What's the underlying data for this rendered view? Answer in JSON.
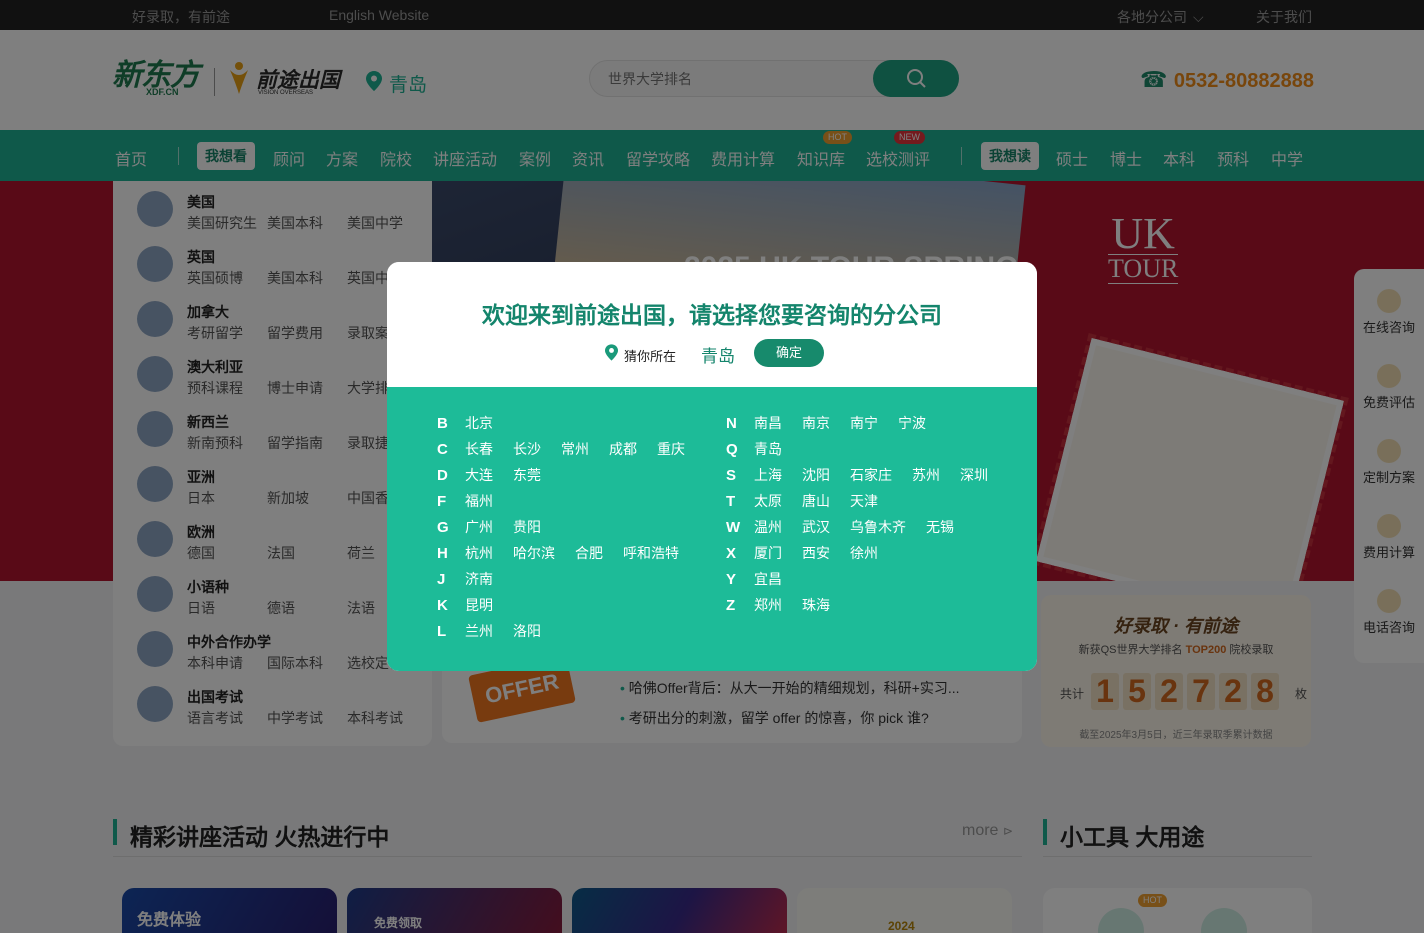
{
  "topbar": {
    "slogan": "好录取，有前途",
    "english": "English Website",
    "branches": "各地分公司",
    "about": "关于我们"
  },
  "header": {
    "logo_xdf": "新东方",
    "logo_xdf_sub": "XDF.CN",
    "logo_vision": "前途出国",
    "logo_vision_sub": "VISION OVERSEAS",
    "city": "青岛",
    "search_placeholder": "世界大学排名",
    "phone": "0532-80882888"
  },
  "nav": {
    "home": "首页",
    "want_see": "我想看",
    "items_see": [
      "顾问",
      "方案",
      "院校",
      "讲座活动",
      "案例",
      "资讯",
      "留学攻略",
      "费用计算",
      "知识库",
      "选校测评"
    ],
    "badge_hot": "HOT",
    "badge_new": "NEW",
    "want_read": "我想读",
    "items_read": [
      "硕士",
      "博士",
      "本科",
      "预科",
      "中学"
    ]
  },
  "banner": {
    "uk": "UK",
    "tour": "TOUR",
    "headline": "2025 UK TOUR SPRING"
  },
  "menu": [
    {
      "title": "美国",
      "subs": [
        "美国研究生",
        "美国本科",
        "美国中学"
      ]
    },
    {
      "title": "英国",
      "subs": [
        "英国硕博",
        "美国本科",
        "英国中学"
      ]
    },
    {
      "title": "加拿大",
      "subs": [
        "考研留学",
        "留学费用",
        "录取案例"
      ]
    },
    {
      "title": "澳大利亚",
      "subs": [
        "预科课程",
        "博士申请",
        "大学排名"
      ]
    },
    {
      "title": "新西兰",
      "subs": [
        "新南预科",
        "留学指南",
        "录取捷报"
      ]
    },
    {
      "title": "亚洲",
      "subs": [
        "日本",
        "新加坡",
        "中国香港"
      ]
    },
    {
      "title": "欧洲",
      "subs": [
        "德国",
        "法国",
        "荷兰"
      ]
    },
    {
      "title": "小语种",
      "subs": [
        "日语",
        "德语",
        "法语"
      ]
    },
    {
      "title": "中外合作办学",
      "subs": [
        "本科申请",
        "国际本科",
        "选校定位"
      ]
    },
    {
      "title": "出国考试",
      "subs": [
        "语言考试",
        "中学考试",
        "本科考试"
      ]
    }
  ],
  "offer": {
    "stamp": "OFFER",
    "news": [
      "哈佛Offer背后：从大一开始的精细规划，科研+实习...",
      "考研出分的刺激，留学 offer 的惊喜，你 pick 谁?"
    ]
  },
  "stats": {
    "slogan": "好录取 · 有前途",
    "sub_prefix": "新获QS世界大学排名",
    "sub_highlight": "TOP200",
    "sub_suffix": "院校录取",
    "total_label": "共计",
    "digits": [
      "1",
      "5",
      "2",
      "7",
      "2",
      "8"
    ],
    "unit": "枚",
    "note": "截至2025年3月5日，近三年录取季累计数据"
  },
  "rightbar": [
    "在线咨询",
    "免费评估",
    "定制方案",
    "费用计算",
    "电话咨询"
  ],
  "sections": {
    "lectures": "精彩讲座活动 火热进行中",
    "more": "more",
    "tools": "小工具 大用途"
  },
  "bottom_cards": {
    "card1": "免费体验",
    "card2": "免费领取",
    "card4": "2024",
    "badge_hot": "HOT"
  },
  "modal": {
    "title": "欢迎来到前途出国，请选择您要咨询的分公司",
    "guess_label": "猜你所在",
    "guess_city": "青岛",
    "confirm": "确定",
    "left": [
      {
        "letter": "B",
        "cities": [
          "北京"
        ]
      },
      {
        "letter": "C",
        "cities": [
          "长春",
          "长沙",
          "常州",
          "成都",
          "重庆"
        ]
      },
      {
        "letter": "D",
        "cities": [
          "大连",
          "东莞"
        ]
      },
      {
        "letter": "F",
        "cities": [
          "福州"
        ]
      },
      {
        "letter": "G",
        "cities": [
          "广州",
          "贵阳"
        ]
      },
      {
        "letter": "H",
        "cities": [
          "杭州",
          "哈尔滨",
          "合肥",
          "呼和浩特"
        ]
      },
      {
        "letter": "J",
        "cities": [
          "济南"
        ]
      },
      {
        "letter": "K",
        "cities": [
          "昆明"
        ]
      },
      {
        "letter": "L",
        "cities": [
          "兰州",
          "洛阳"
        ]
      }
    ],
    "right": [
      {
        "letter": "N",
        "cities": [
          "南昌",
          "南京",
          "南宁",
          "宁波"
        ]
      },
      {
        "letter": "Q",
        "cities": [
          "青岛"
        ]
      },
      {
        "letter": "S",
        "cities": [
          "上海",
          "沈阳",
          "石家庄",
          "苏州",
          "深圳"
        ]
      },
      {
        "letter": "T",
        "cities": [
          "太原",
          "唐山",
          "天津"
        ]
      },
      {
        "letter": "W",
        "cities": [
          "温州",
          "武汉",
          "乌鲁木齐",
          "无锡"
        ]
      },
      {
        "letter": "X",
        "cities": [
          "厦门",
          "西安",
          "徐州"
        ]
      },
      {
        "letter": "Y",
        "cities": [
          "宜昌"
        ]
      },
      {
        "letter": "Z",
        "cities": [
          "郑州",
          "珠海"
        ]
      }
    ]
  },
  "colors": {
    "brand_green": "#1fb395",
    "modal_green": "#1dbb98",
    "title_green": "#14856c",
    "phone_orange": "#f08c19",
    "stat_orange": "#d2691e"
  }
}
